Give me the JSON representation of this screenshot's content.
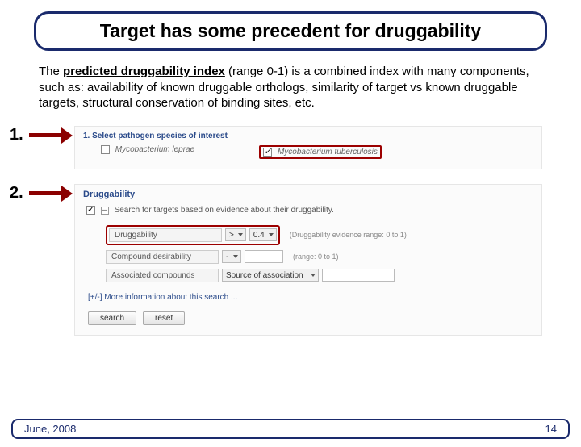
{
  "title": "Target has some precedent for druggability",
  "intro": {
    "lead": "The ",
    "underlined": "predicted druggability index",
    "rest": " (range 0-1) is a combined index with many components, such as: availability of known druggable orthologs, similarity of target vs known druggable targets, structural conservation of binding sites, etc."
  },
  "steps": {
    "s1": "1.",
    "s2": "2."
  },
  "panel1": {
    "heading_num": "1.",
    "heading_text": "Select pathogen species of interest",
    "species": [
      {
        "label": "Mycobacterium leprae",
        "checked": false
      },
      {
        "label": "Mycobacterium tuberculosis",
        "checked": true
      }
    ]
  },
  "panel2": {
    "title": "Druggability",
    "enable_label": "Search for targets based on evidence about their druggability.",
    "rows": {
      "druggability": {
        "label": "Druggability",
        "op": ">",
        "value": "0.4",
        "hint": "(Druggability evidence range: 0 to 1)"
      },
      "desirability": {
        "label": "Compound desirability",
        "op": "-",
        "value": "",
        "hint": "(range: 0 to 1)"
      },
      "associated": {
        "label": "Associated compounds",
        "src_label": "Source of association",
        "value": ""
      }
    },
    "more": "[+/-]  More information about this search ...",
    "buttons": {
      "search": "search",
      "reset": "reset"
    }
  },
  "footer": {
    "date": "June, 2008",
    "page": "14"
  }
}
